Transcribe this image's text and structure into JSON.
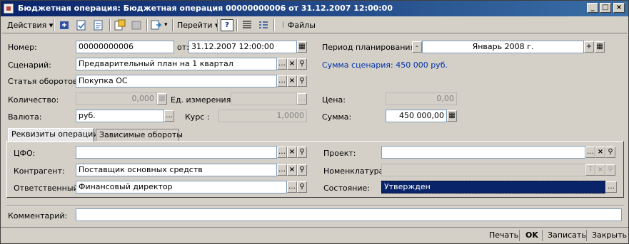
{
  "window": {
    "title": "Бюджетная операция: Бюджетная операция 00000000006 от 31.12.2007 12:00:00"
  },
  "toolbar": {
    "actions_label": "Действия",
    "goto_label": "Перейти",
    "help_label": "?",
    "files_label": "Файлы"
  },
  "form": {
    "number_label": "Номер:",
    "number_value": "00000000006",
    "date_label": "от:",
    "date_value": "31.12.2007 12:00:00",
    "period_label": "Период планирования:",
    "period_minus": "-",
    "period_value": "Январь 2008 г.",
    "period_plus": "+",
    "scenario_label": "Сценарий:",
    "scenario_value": "Предварительный план на 1 квартал",
    "scenario_sum": "Сумма сценария: 450 000 руб.",
    "article_label": "Статья оборотов:",
    "article_value": "Покупка ОС",
    "quantity_label": "Количество:",
    "quantity_value": "0,000",
    "unit_label": "Ед. измерения:",
    "unit_value": "",
    "price_label": "Цена:",
    "price_value": "0,00",
    "currency_label": "Валюта:",
    "currency_value": "руб.",
    "rate_label": "Курс :",
    "rate_value": "1,0000",
    "sum_label": "Сумма:",
    "sum_value": "450 000,00"
  },
  "tabs": [
    {
      "label": "Реквизиты операции"
    },
    {
      "label": "Зависимые обороты"
    }
  ],
  "panel": {
    "cfo_label": "ЦФО:",
    "cfo_value": "",
    "project_label": "Проект:",
    "project_value": "",
    "contractor_label": "Контрагент:",
    "contractor_value": "Поставщик основных средств",
    "nomenclature_label": "Номенклатура:",
    "nomenclature_value": "",
    "responsible_label": "Ответственный:",
    "responsible_value": "Финансовый директор",
    "state_label": "Состояние:",
    "state_value": "Утвержден"
  },
  "comment": {
    "label": "Комментарий:",
    "value": ""
  },
  "footer": {
    "print_label": "Печать",
    "ok_label": "OK",
    "save_label": "Записать",
    "close_label": "Закрыть"
  },
  "colors": {
    "title_start": "#0a246a",
    "title_end": "#3a6ea5",
    "link_text": "#0033aa",
    "selection": "#0a246a"
  }
}
